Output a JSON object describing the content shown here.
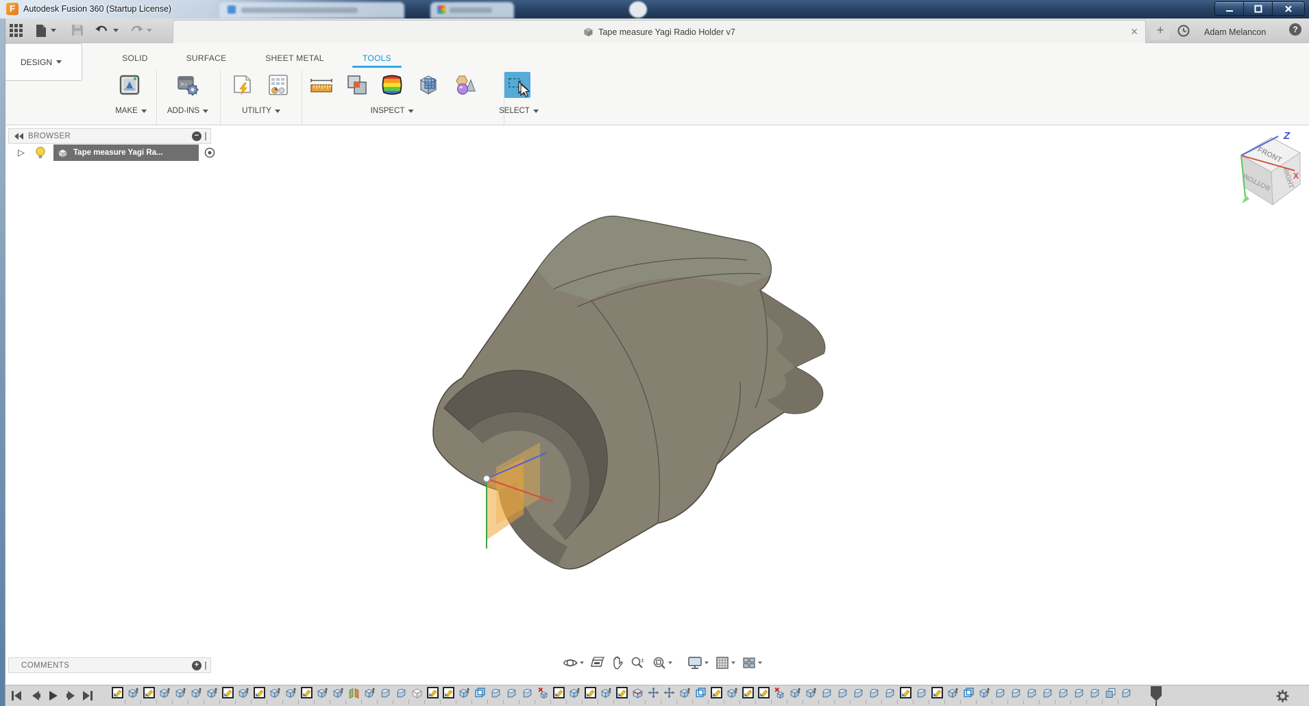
{
  "window": {
    "title": "Autodesk Fusion 360 (Startup License)",
    "logo_letter": "F"
  },
  "session": {
    "user_name": "Adam Melancon",
    "help_glyph": "?",
    "new_tab_glyph": "+"
  },
  "document_tab": {
    "title": "Tape measure  Yagi Radio Holder v7",
    "close_glyph": "✕"
  },
  "ribbon": {
    "workspace_label": "DESIGN",
    "tabs": [
      {
        "label": "SOLID"
      },
      {
        "label": "SURFACE"
      },
      {
        "label": "SHEET METAL"
      },
      {
        "label": "TOOLS",
        "active": true
      }
    ],
    "groups": [
      {
        "label": "MAKE"
      },
      {
        "label": "ADD-INS"
      },
      {
        "label": "UTILITY"
      },
      {
        "label": "INSPECT"
      },
      {
        "label": "SELECT"
      }
    ]
  },
  "browser_panel": {
    "header_label": "BROWSER",
    "document_item": "Tape measure  Yagi Ra...",
    "expand_glyph": "▷"
  },
  "comments_panel": {
    "header_label": "COMMENTS"
  },
  "viewcube": {
    "front_label": "FRONT",
    "right_label": "RIGHT",
    "bottom_label": "BOTTOM",
    "z_label": "Z",
    "x_label": "X"
  },
  "timeline": {
    "features": [
      "sketch",
      "extrude",
      "sketch",
      "extrude",
      "extrude",
      "extrude",
      "extrude",
      "sketch",
      "extrude",
      "sketch",
      "extrude",
      "extrude",
      "sketch",
      "extrude",
      "extrude",
      "mirror",
      "extrude",
      "fillet",
      "fillet",
      "body",
      "sketch",
      "sketch",
      "extrude",
      "plane",
      "fillet",
      "fillet",
      "fillet",
      "delete",
      "sketch",
      "extrude",
      "sketch",
      "extrude",
      "sketch",
      "split",
      "move",
      "move",
      "extrude",
      "plane",
      "sketch",
      "extrude",
      "sketch",
      "sketch",
      "delete",
      "extrude",
      "extrude",
      "fillet",
      "fillet",
      "fillet",
      "fillet",
      "fillet",
      "sketch",
      "fillet",
      "sketch",
      "extrude",
      "plane",
      "extrude",
      "fillet",
      "fillet",
      "fillet",
      "fillet",
      "fillet",
      "fillet",
      "fillet",
      "combine",
      "fillet"
    ]
  },
  "colors": {
    "accent_blue": "#0a96d6",
    "select_highlight": "#55aada",
    "model_gray": "#868070",
    "origin_plane_orange": "#f0a73b",
    "titlebar_blue": "#2a4568"
  }
}
